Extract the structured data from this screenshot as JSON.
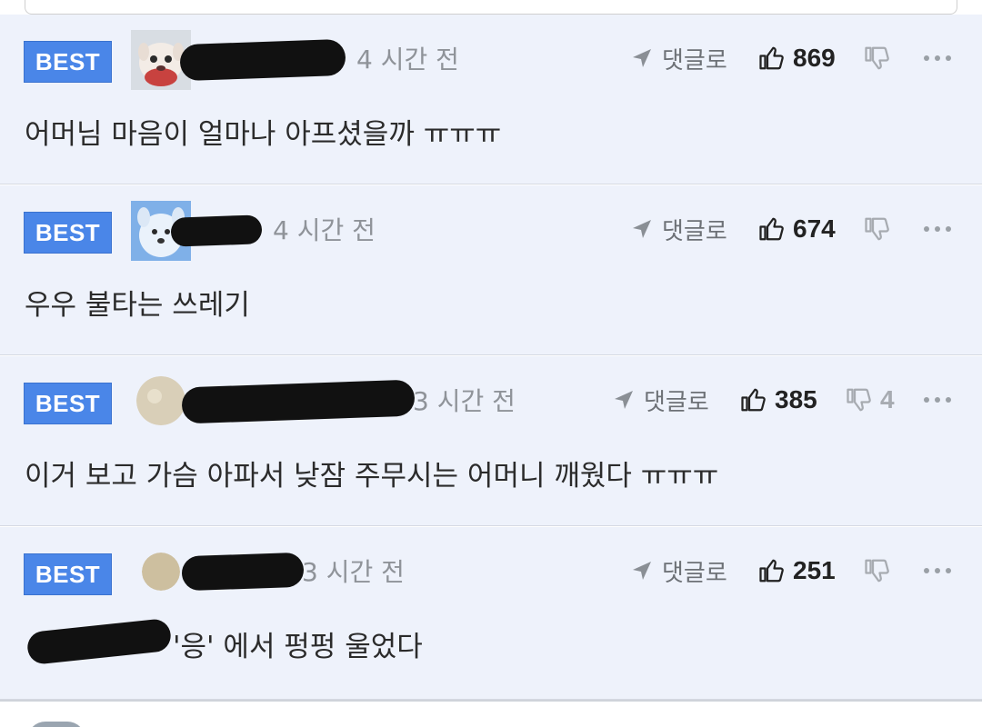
{
  "comments": [
    {
      "badge": "BEST",
      "time": "4 시간 전",
      "reply_label": "댓글로",
      "likes": "869",
      "dislikes": "",
      "text": "어머님 마음이 얼마나 아프셨을까 ㅠㅠㅠ"
    },
    {
      "badge": "BEST",
      "time": "4 시간 전",
      "reply_label": "댓글로",
      "likes": "674",
      "dislikes": "",
      "text": "우우 불타는 쓰레기"
    },
    {
      "badge": "BEST",
      "time": "3 시간 전",
      "reply_label": "댓글로",
      "likes": "385",
      "dislikes": "4",
      "text": "이거 보고 가슴 아파서 낮잠 주무시는 어머니 깨웠다 ㅠㅠㅠ"
    },
    {
      "badge": "BEST",
      "time": "3 시간 전",
      "reply_label": "댓글로",
      "likes": "251",
      "dislikes": "",
      "text": "'응' 에서 펑펑 울었다"
    }
  ],
  "colors": {
    "badge_blue": "#4a86e8",
    "comment_bg": "#eef2fb",
    "text_dark": "#2b2b2b",
    "text_muted": "#8f9399"
  },
  "icons": {
    "reply": "send-arrow-icon",
    "like": "thumbs-up-icon",
    "dislike": "thumbs-down-icon",
    "more": "more-dots-icon"
  }
}
